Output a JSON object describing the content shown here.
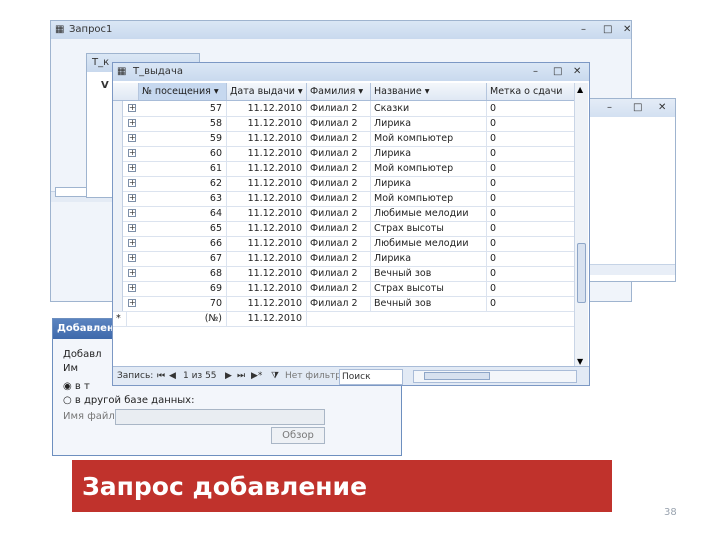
{
  "back_window": {
    "title": "Запрос1",
    "controls": [
      "–",
      "□",
      "✕"
    ]
  },
  "window_tx": {
    "title": "Т_к",
    "subtitle": "V"
  },
  "mid_window": {
    "title": "",
    "controls": [
      "–",
      "□",
      "✕"
    ]
  },
  "main_window": {
    "title": "Т_выдача",
    "controls": [
      "–",
      "□",
      "✕"
    ],
    "columns": [
      "№ посещения",
      "Дата выдачи",
      "Фамилия",
      "Название",
      "Метка о сдачи"
    ],
    "rows": [
      {
        "no": "57",
        "date": "11.12.2010",
        "fam": "Филиал 2",
        "name": "Сказки",
        "flag": "0"
      },
      {
        "no": "58",
        "date": "11.12.2010",
        "fam": "Филиал 2",
        "name": "Лирика",
        "flag": "0"
      },
      {
        "no": "59",
        "date": "11.12.2010",
        "fam": "Филиал 2",
        "name": "Мой компьютер",
        "flag": "0"
      },
      {
        "no": "60",
        "date": "11.12.2010",
        "fam": "Филиал 2",
        "name": "Лирика",
        "flag": "0"
      },
      {
        "no": "61",
        "date": "11.12.2010",
        "fam": "Филиал 2",
        "name": "Мой компьютер",
        "flag": "0"
      },
      {
        "no": "62",
        "date": "11.12.2010",
        "fam": "Филиал 2",
        "name": "Лирика",
        "flag": "0"
      },
      {
        "no": "63",
        "date": "11.12.2010",
        "fam": "Филиал 2",
        "name": "Мой компьютер",
        "flag": "0"
      },
      {
        "no": "64",
        "date": "11.12.2010",
        "fam": "Филиал 2",
        "name": "Любимые мелодии",
        "flag": "0"
      },
      {
        "no": "65",
        "date": "11.12.2010",
        "fam": "Филиал 2",
        "name": "Страх высоты",
        "flag": "0"
      },
      {
        "no": "66",
        "date": "11.12.2010",
        "fam": "Филиал 2",
        "name": "Любимые мелодии",
        "flag": "0"
      },
      {
        "no": "67",
        "date": "11.12.2010",
        "fam": "Филиал 2",
        "name": "Лирика",
        "flag": "0"
      },
      {
        "no": "68",
        "date": "11.12.2010",
        "fam": "Филиал 2",
        "name": "Вечный зов",
        "flag": "0"
      },
      {
        "no": "69",
        "date": "11.12.2010",
        "fam": "Филиал 2",
        "name": "Страх высоты",
        "flag": "0"
      },
      {
        "no": "70",
        "date": "11.12.2010",
        "fam": "Филиал 2",
        "name": "Вечный зов",
        "flag": "0"
      }
    ],
    "new_row": {
      "marker": "*",
      "no": "(№)",
      "date": "11.12.2010"
    },
    "nav": {
      "label": "Запись:",
      "position": "1 из 55",
      "filter": "Нет фильтра",
      "search": "Поиск"
    }
  },
  "dialog": {
    "title": "Добавление",
    "line1": "Добавл",
    "line2": "Им",
    "opt1": "в т",
    "opt2": "в другой базе данных:",
    "file_label": "Имя файла:",
    "file_value": "",
    "browse": "Обзор"
  },
  "banner": {
    "text": "Запрос добавление",
    "color": "#c0322c"
  },
  "page_number": "38"
}
